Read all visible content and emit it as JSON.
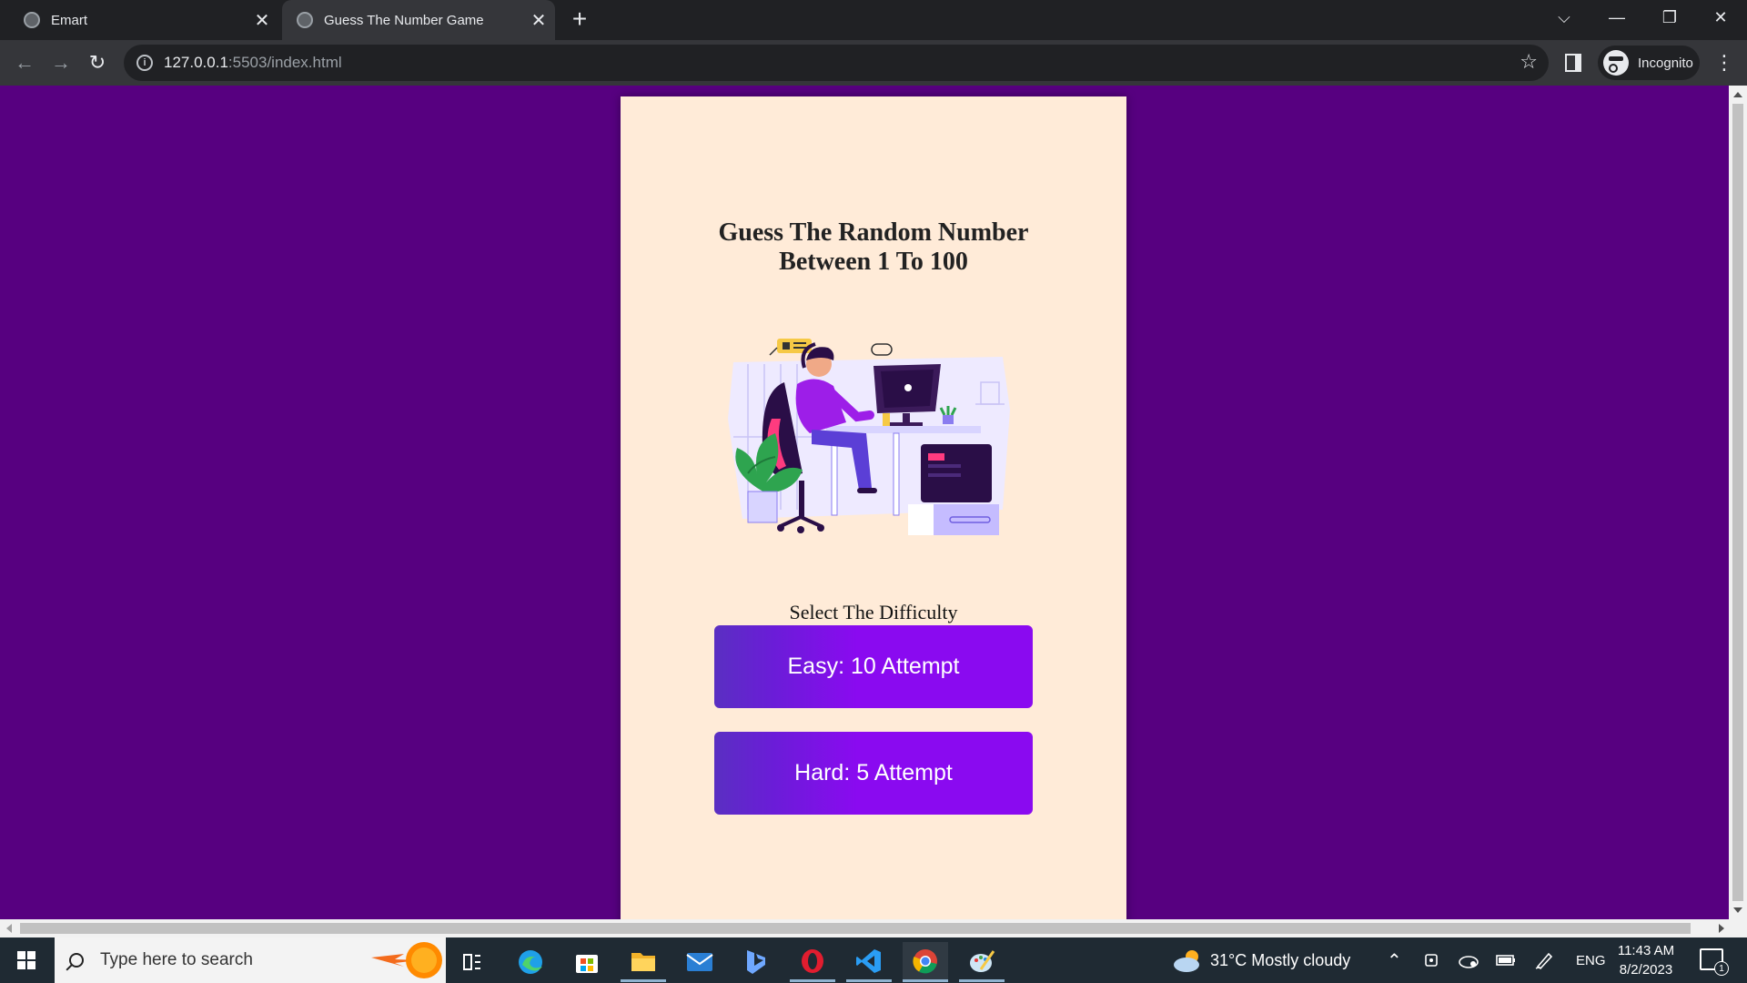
{
  "browser": {
    "tabs": [
      {
        "title": "Emart",
        "active": false
      },
      {
        "title": "Guess The Number Game",
        "active": true
      }
    ],
    "address": {
      "host": "127.0.0.1",
      "path": ":5503/index.html"
    },
    "profile_label": "Incognito"
  },
  "page": {
    "heading_line1": "Guess The Random Number",
    "heading_line2": "Between 1 To 100",
    "difficulty_label": "Select The Difficulty",
    "buttons": {
      "easy": "Easy: 10 Attempt",
      "hard": "Hard: 5 Attempt"
    },
    "colors": {
      "background": "#570080",
      "card": "#ffebd8",
      "button": "#8a0af0"
    }
  },
  "taskbar": {
    "search_placeholder": "Type here to search",
    "weather": "31°C  Mostly cloudy",
    "language": "ENG",
    "time": "11:43 AM",
    "date": "8/2/2023",
    "notification_count": "1"
  }
}
